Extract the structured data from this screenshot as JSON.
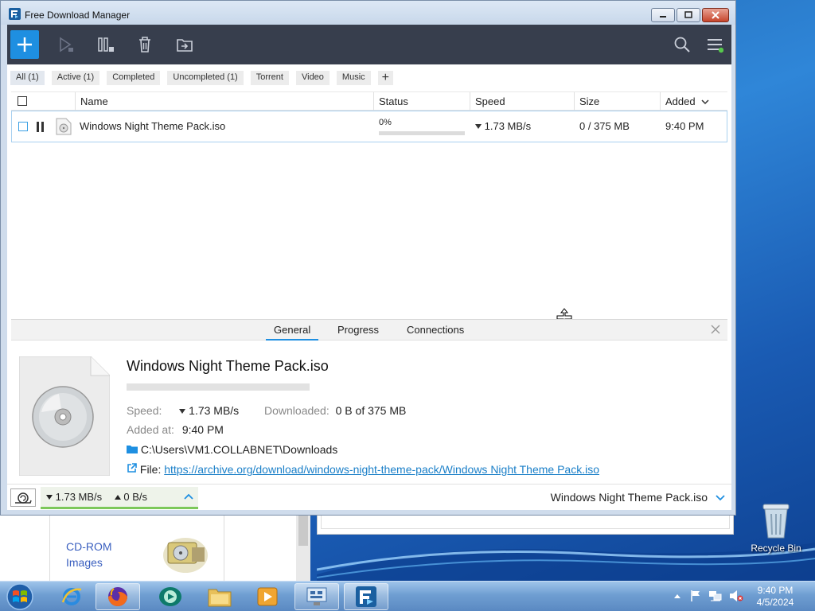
{
  "window": {
    "title": "Free Download Manager"
  },
  "filters": [
    "All (1)",
    "Active (1)",
    "Completed",
    "Uncompleted (1)",
    "Torrent",
    "Video",
    "Music"
  ],
  "filter_add": "+",
  "columns": {
    "name": "Name",
    "status": "Status",
    "speed": "Speed",
    "size": "Size",
    "added": "Added"
  },
  "download": {
    "name": "Windows Night Theme Pack.iso",
    "progress_text": "0%",
    "progress_fraction": 0,
    "speed": "1.73 MB/s",
    "size": "0 / 375 MB",
    "added": "9:40 PM"
  },
  "details": {
    "tabs": [
      "General",
      "Progress",
      "Connections"
    ],
    "title": "Windows Night Theme Pack.iso",
    "speed_label": "Speed:",
    "speed_value": "1.73 MB/s",
    "downloaded_label": "Downloaded:",
    "downloaded_value": "0 B of 375 MB",
    "added_label": "Added at:",
    "added_value": "9:40 PM",
    "folder": "C:\\Users\\VM1.COLLABNET\\Downloads",
    "file_label": "File:",
    "file_url": "https://archive.org/download/windows-night-theme-pack/Windows Night Theme Pack.iso"
  },
  "statusbar": {
    "download_speed": "1.73 MB/s",
    "upload_speed": "0 B/s",
    "current_file": "Windows Night Theme Pack.iso"
  },
  "background": {
    "cdrom_label": "CD-ROM Images"
  },
  "desktop": {
    "recycle_bin": "Recycle Bin"
  },
  "taskbar": {
    "time": "9:40 PM",
    "date": "4/5/2024"
  },
  "colors": {
    "accent": "#1e8fe1",
    "toolbar": "#373e4d",
    "speed_ok": "#7cc85a"
  }
}
